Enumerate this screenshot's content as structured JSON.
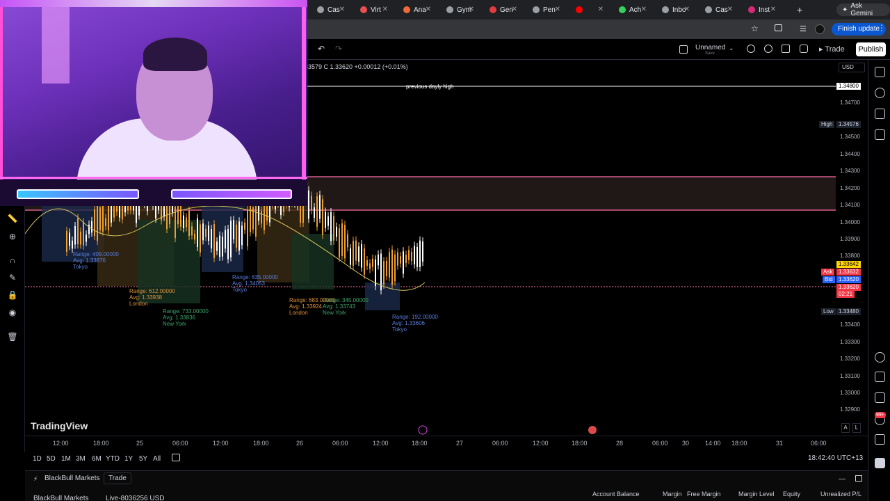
{
  "browser": {
    "tabs": [
      {
        "label": "Cas",
        "color": "#9aa0a6"
      },
      {
        "label": "Virt",
        "color": "#e94f4f"
      },
      {
        "label": "Ana",
        "color": "#f06a3a"
      },
      {
        "label": "Gym",
        "color": "#9aa0a6"
      },
      {
        "label": "Gen",
        "color": "#e03c3c"
      },
      {
        "label": "Pen",
        "color": "#9aa0a6"
      },
      {
        "label": "",
        "color": "#ff0000"
      },
      {
        "label": "Ach",
        "color": "#36d05c"
      },
      {
        "label": "Inbo",
        "color": "#9aa0a6"
      },
      {
        "label": "Cas",
        "color": "#9aa0a6"
      },
      {
        "label": "Inst",
        "color": "#d62976"
      }
    ],
    "new_tab": "+",
    "ask_gemini": "Ask Gemini",
    "finish_update": "Finish update"
  },
  "toolbar": {
    "layout_name": "Unnamed",
    "layout_save": "Save",
    "trade_label": "Trade",
    "publish_label": "Publish"
  },
  "chart": {
    "ohlc_text": "33579  C 1.33620  +0.00012 (+0.01%)",
    "currency": "USD",
    "previous_daily_high_label": "previous dayly high",
    "price_labels": [
      "1.34700",
      "1.34500",
      "1.34400",
      "1.34300",
      "1.34200",
      "1.34100",
      "1.34000",
      "1.33900",
      "1.33800",
      "1.33400",
      "1.33300",
      "1.33200",
      "1.33100",
      "1.33000",
      "1.32900"
    ],
    "price_tags": {
      "pdh": "1.34800",
      "high_label": "High",
      "high": "1.34576",
      "price_top": "1.33642",
      "ask_label": "Ask",
      "ask": "1.33632",
      "bid_label": "Bid",
      "bid": "1.33620",
      "last": "1.33620",
      "countdown": "02:21",
      "low_label": "Low",
      "low": "1.33480"
    },
    "sessions": [
      {
        "range": "Range: 409.00000",
        "avg": "Avg: 1.33876",
        "name": "Tokyo",
        "color": "#5b7ddb"
      },
      {
        "range": "Range: 612.00000",
        "avg": "Avg: 1.33938",
        "name": "London",
        "color": "#e0913c"
      },
      {
        "range": "Range: 733.00000",
        "avg": "Avg: 1.33836",
        "name": "New York",
        "color": "#3fa66a"
      },
      {
        "range": "Range: 635.00000",
        "avg": "Avg: 1.34053",
        "name": "Tokyo",
        "color": "#5b7ddb"
      },
      {
        "range": "Range: 683.00000",
        "avg": "Avg: 1.33924",
        "name": "London",
        "color": "#e0913c"
      },
      {
        "range": "Range: 345.00000",
        "avg": "Avg: 1.33743",
        "name": "New York",
        "color": "#3fa66a"
      },
      {
        "range": "Range: 192.00000",
        "avg": "Avg: 1.33606",
        "name": "Tokyo",
        "color": "#5b7ddb"
      }
    ],
    "time_labels": [
      "12:00",
      "18:00",
      "25",
      "06:00",
      "12:00",
      "18:00",
      "26",
      "06:00",
      "12:00",
      "18:00",
      "27",
      "06:00",
      "12:00",
      "18:00",
      "28",
      "06:00",
      "30",
      "14:00",
      "18:00",
      "31",
      "06:00"
    ],
    "logo": "TradingView",
    "colors": {
      "up": "#ffffff",
      "down": "#f0a030",
      "pink": "#ff6fa8",
      "zone": "#3a2a2a"
    }
  },
  "ranges": [
    "1D",
    "5D",
    "1M",
    "3M",
    "6M",
    "YTD",
    "1Y",
    "5Y",
    "All"
  ],
  "clock": "18:42:40 UTC+13",
  "axis_buttons": {
    "auto": "A",
    "log": "L"
  },
  "trade_panel": {
    "broker": "BlackBull Markets",
    "trade_btn": "Trade",
    "account_broker": "BlackBull Markets",
    "account_id": "Live-8036256 USD",
    "columns": [
      "Account Balance",
      "Margin",
      "Free Margin",
      "Margin Level",
      "Equity",
      "Unrealized P/L"
    ]
  },
  "notifications": "99+"
}
